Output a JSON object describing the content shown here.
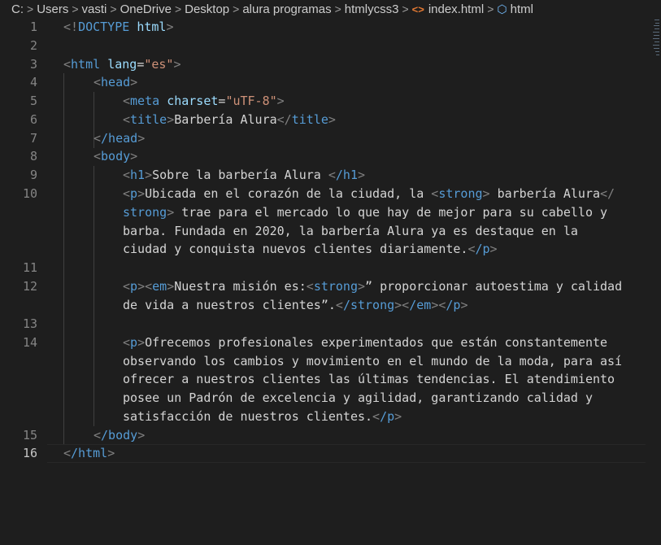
{
  "breadcrumb": {
    "items": [
      "C:",
      "Users",
      "vasti",
      "OneDrive",
      "Desktop",
      "alura programas",
      "htmlycss3",
      "index.html",
      "html"
    ]
  },
  "editor": {
    "active_line": "16",
    "line_numbers": [
      "1",
      "2",
      "3",
      "4",
      "5",
      "6",
      "7",
      "8",
      "9",
      "10",
      "11",
      "12",
      "13",
      "14",
      "15",
      "16"
    ]
  },
  "code": {
    "l1_doctype": "DOCTYPE",
    "l1_html": "html",
    "l3_tag": "html",
    "l3_attr": "lang",
    "l3_val": "\"es\"",
    "l4_tag": "head",
    "l5_tag": "meta",
    "l5_attr": "charset",
    "l5_val": "\"uTF-8\"",
    "l6_tag": "title",
    "l6_text": "Barbería Alura",
    "l7_tag": "/head",
    "l8_tag": "body",
    "l9_tag": "h1",
    "l9_text": "Sobre la barbería Alura ",
    "l9_close": "/h1",
    "l10_p": "p",
    "l10_text1": "Ubicada en el corazón de la ciudad, la ",
    "l10_strong": "strong",
    "l10_text2": " barbería Alura",
    "l10_close_strong_a": "/",
    "l10_close_strong_b": "strong",
    "l10_text3": " trae para el mercado lo que hay de mejor para su cabello y",
    "l10_text4": "barba. Fundada en 2020, la barbería Alura ya es destaque en la",
    "l10_text5": "ciudad y conquista nuevos clientes diariamente.",
    "l10_close_p": "/p",
    "l12_p": "p",
    "l12_em": "em",
    "l12_text1": "Nuestra misión es:",
    "l12_strong": "strong",
    "l12_text2": "” proporcionar autoestima y calidad",
    "l12_text3": "de vida a nuestros clientes”.",
    "l12_close_strong": "/strong",
    "l12_close_em": "/em",
    "l12_close_p": "/p",
    "l14_p": "p",
    "l14_text1": "Ofrecemos profesionales experimentados que están constantemente",
    "l14_text2": "observando los cambios y movimiento en el mundo de la moda, para así",
    "l14_text3": "ofrecer a nuestros clientes las últimas tendencias. El atendimiento",
    "l14_text4": "posee un Padrón de excelencia y agilidad, garantizando calidad y",
    "l14_text5": "satisfacción de nuestros clientes.",
    "l14_close_p": "/p",
    "l15_tag": "/body",
    "l16_tag": "/html"
  },
  "colors": {
    "background": "#1e1e1e",
    "tag": "#569cd6",
    "attribute": "#9cdcfe",
    "string": "#ce9178",
    "text": "#d4d4d4"
  }
}
